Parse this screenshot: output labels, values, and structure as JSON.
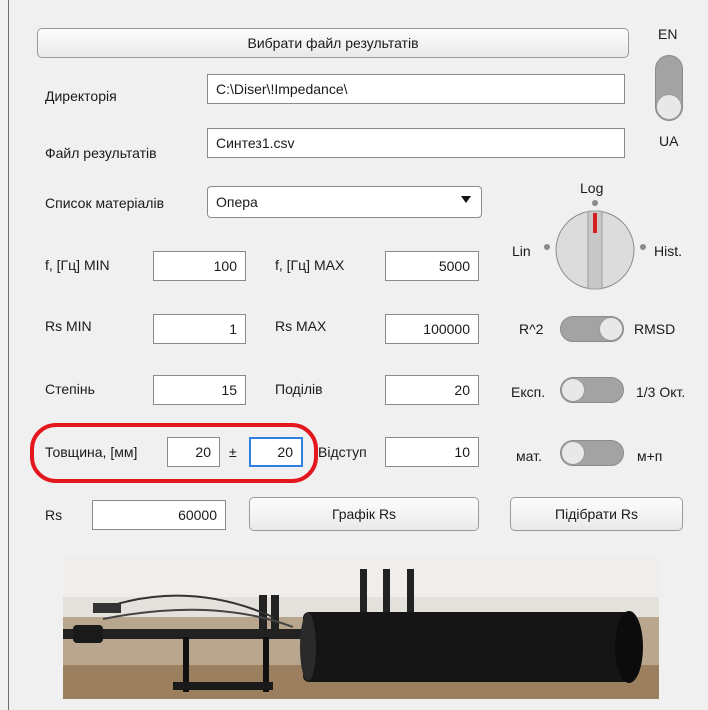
{
  "top_button": "Вибрати файл результатів",
  "lang_toggle": {
    "top_label": "EN",
    "bottom_label": "UA",
    "selected": "UA"
  },
  "directory": {
    "label": "Директорія",
    "value": "C:\\Diser\\!Impedance\\"
  },
  "results_file": {
    "label": "Файл результатів",
    "value": "Синтез1.csv"
  },
  "materials": {
    "label": "Список матеріалів",
    "selected": "Опера"
  },
  "scale_knob": {
    "top": "Log",
    "left": "Lin",
    "right": "Hist.",
    "selected": "Log"
  },
  "freq_min": {
    "label": "f, [Гц] MIN",
    "value": "100"
  },
  "freq_max": {
    "label": "f, [Гц] MAX",
    "value": "5000"
  },
  "rs_min": {
    "label": "Rs MIN",
    "value": "1"
  },
  "rs_max": {
    "label": "Rs MAX",
    "value": "100000"
  },
  "fit_toggle": {
    "left": "R^2",
    "right": "RMSD",
    "selected": "R^2"
  },
  "degree": {
    "label": "Степінь",
    "value": "15"
  },
  "divisions": {
    "label": "Поділів",
    "value": "20"
  },
  "band_toggle": {
    "left": "Експ.",
    "right": "1/3 Окт.",
    "selected": "Експ."
  },
  "thickness": {
    "label": "Товщина, [мм]",
    "value": "20",
    "pm": "±",
    "tolerance": "20"
  },
  "offset": {
    "label": "Відступ",
    "value": "10"
  },
  "model_toggle": {
    "left": "мат.",
    "right": "м+п",
    "selected": "мат."
  },
  "rs": {
    "label": "Rs",
    "value": "60000"
  },
  "plot_button": "Графік Rs",
  "fit_button": "Підібрати Rs",
  "colors": {
    "highlight": "#e3171d",
    "toggle_track": "#a3a3a3",
    "focus": "#2f7fe0"
  },
  "photo": {
    "subject": "impedance-tube-apparatus"
  }
}
